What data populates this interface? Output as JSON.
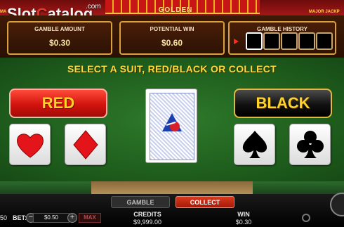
{
  "branding": {
    "site_logo_pre": "Slot",
    "site_logo_c": "C",
    "site_logo_post": "atalog",
    "site_com": ".com",
    "game_logo": "GOLDEN",
    "left_edge_text": "MA",
    "right_edge_text": "MAJOR JACKP"
  },
  "info_panel": {
    "gamble_amount_label": "GAMBLE AMOUNT",
    "gamble_amount_value": "$0.30",
    "potential_win_label": "POTENTIAL WIN",
    "potential_win_value": "$0.60",
    "gamble_history_label": "GAMBLE HISTORY",
    "history_slots": [
      "",
      "",
      "",
      "",
      ""
    ]
  },
  "prompt": "SELECT A SUIT, RED/BLACK OR COLLECT",
  "buttons": {
    "red": "RED",
    "black": "BLACK"
  },
  "suits": {
    "hearts": "heart-icon",
    "diamonds": "diamond-icon",
    "spades": "spade-icon",
    "clubs": "club-icon"
  },
  "bottom_bar": {
    "gamble_tab": "GAMBLE",
    "collect_tab": "COLLECT",
    "bet_label": "BET:",
    "bet_value": "$0.50",
    "bet_prefix": "50",
    "max_label": "MAX",
    "credits_label": "CREDITS",
    "credits_value": "$9,999.00",
    "win_label": "WIN",
    "win_value": "$0.30"
  },
  "colors": {
    "felt": "#1d5a1b",
    "red_button": "#d3130d",
    "prompt_yellow": "#ffd83a",
    "collect_active": "#d93a1e"
  }
}
